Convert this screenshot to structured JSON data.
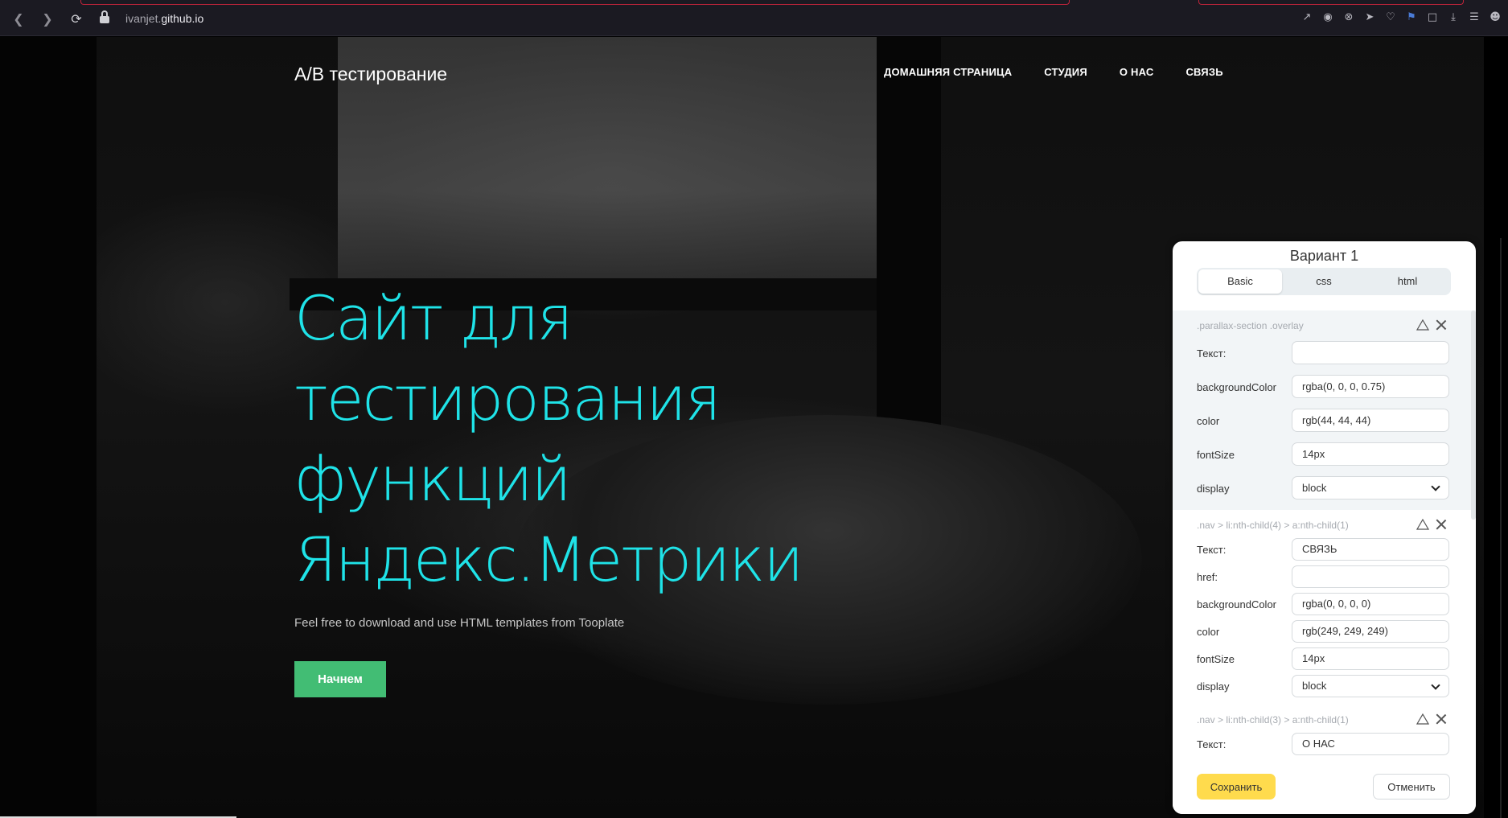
{
  "browser": {
    "url_prefix": "ivanjet.",
    "url_domain": "github.io",
    "nav_icons": [
      "back-icon",
      "forward-icon",
      "reload-icon"
    ],
    "toolbar_icons": [
      "share-icon",
      "camera-icon",
      "adblock-icon",
      "send-icon",
      "heart-icon",
      "flag-icon",
      "cube-icon",
      "download-icon",
      "menu-icon",
      "profile-icon"
    ]
  },
  "site": {
    "title": "A/B тестирование",
    "nav": [
      "ДОМАШНЯЯ СТРАНИЦА",
      "СТУДИЯ",
      "О НАС",
      "СВЯЗЬ"
    ],
    "heading_lines": [
      "Сайт для",
      "тестирования",
      "функций",
      "Яндекс.Метрики"
    ],
    "subtitle": "Feel free to download and use HTML templates from Tooplate",
    "cta": "Начнем"
  },
  "panel": {
    "title": "Вариант 1",
    "tabs": [
      "Basic",
      "css",
      "html"
    ],
    "active_tab": "Basic",
    "blocks": [
      {
        "selector": ".parallax-section .overlay",
        "fields": [
          {
            "label": "Текст:",
            "value": ""
          },
          {
            "label": "backgroundColor",
            "value": "rgba(0, 0, 0, 0.75)"
          },
          {
            "label": "color",
            "value": "rgb(44, 44, 44)"
          },
          {
            "label": "fontSize",
            "value": "14px"
          },
          {
            "label": "display",
            "value": "block"
          }
        ]
      },
      {
        "selector": ".nav > li:nth-child(4) > a:nth-child(1)",
        "fields": [
          {
            "label": "Текст:",
            "value": "СВЯЗЬ"
          },
          {
            "label": "href:",
            "value": ""
          },
          {
            "label": "backgroundColor",
            "value": "rgba(0, 0, 0, 0)"
          },
          {
            "label": "color",
            "value": "rgb(249, 249, 249)"
          },
          {
            "label": "fontSize",
            "value": "14px"
          },
          {
            "label": "display",
            "value": "block"
          }
        ]
      },
      {
        "selector": ".nav > li:nth-child(3) > a:nth-child(1)",
        "fields": [
          {
            "label": "Текст:",
            "value": "О НАС"
          }
        ]
      }
    ],
    "save_label": "Сохранить",
    "cancel_label": "Отменить"
  },
  "colors": {
    "heading": "#1fe3e8",
    "cta_bg": "#42bd74",
    "save_bg": "#ffdb4d",
    "chrome_accent": "#c0243a"
  }
}
